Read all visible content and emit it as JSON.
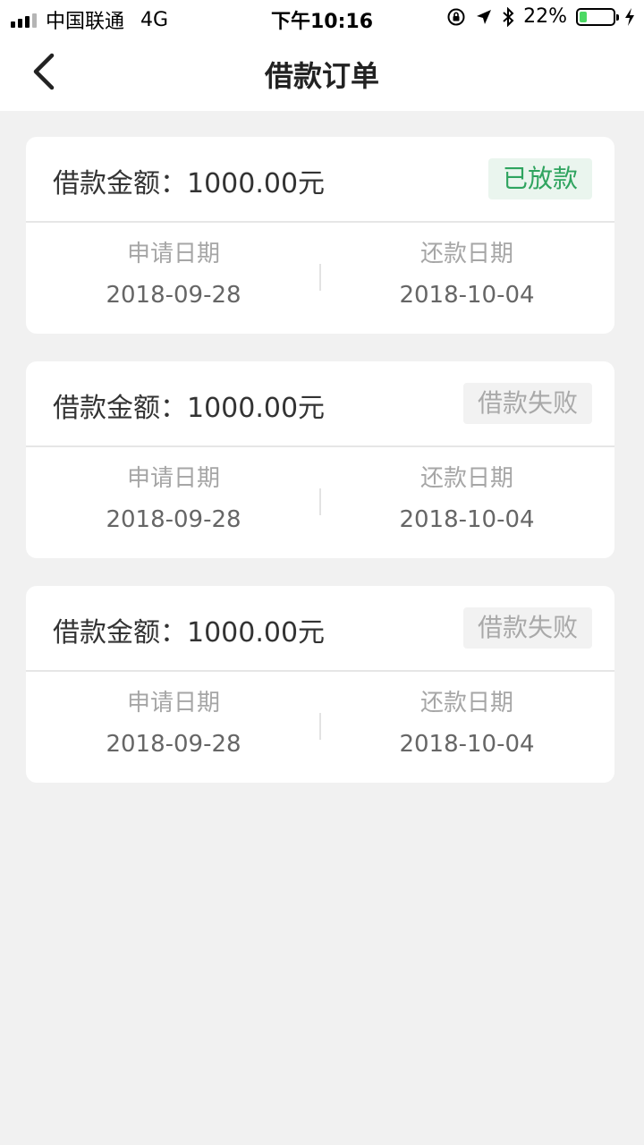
{
  "status_bar": {
    "carrier": "中国联通",
    "network": "4G",
    "time": "下午10:16",
    "battery": "22%",
    "battery_level": 0.22,
    "icons": [
      "orientation-lock-icon",
      "location-arrow-icon",
      "bluetooth-icon",
      "charging-bolt-icon"
    ]
  },
  "nav": {
    "title": "借款订单",
    "back_icon": "chevron-left-icon"
  },
  "colors": {
    "status_ok": "#2fa45f",
    "status_fail": "#a9a9a9",
    "battery_fill": "#4cd964"
  },
  "orders": [
    {
      "amount": "借款金额：1000.00元",
      "status": "已放款",
      "apply_label": "申请日期",
      "apply_date": "2018-09-28",
      "repay_label": "还款日期",
      "repay_date": "2018-10-04"
    },
    {
      "amount": "借款金额：1000.00元",
      "status": "借款失败",
      "apply_label": "申请日期",
      "apply_date": "2018-09-28",
      "repay_label": "还款日期",
      "repay_date": "2018-10-04"
    },
    {
      "amount": "借款金额：1000.00元",
      "status": "借款失败",
      "apply_label": "申请日期",
      "apply_date": "2018-09-28",
      "repay_label": "还款日期",
      "repay_date": "2018-10-04"
    }
  ]
}
